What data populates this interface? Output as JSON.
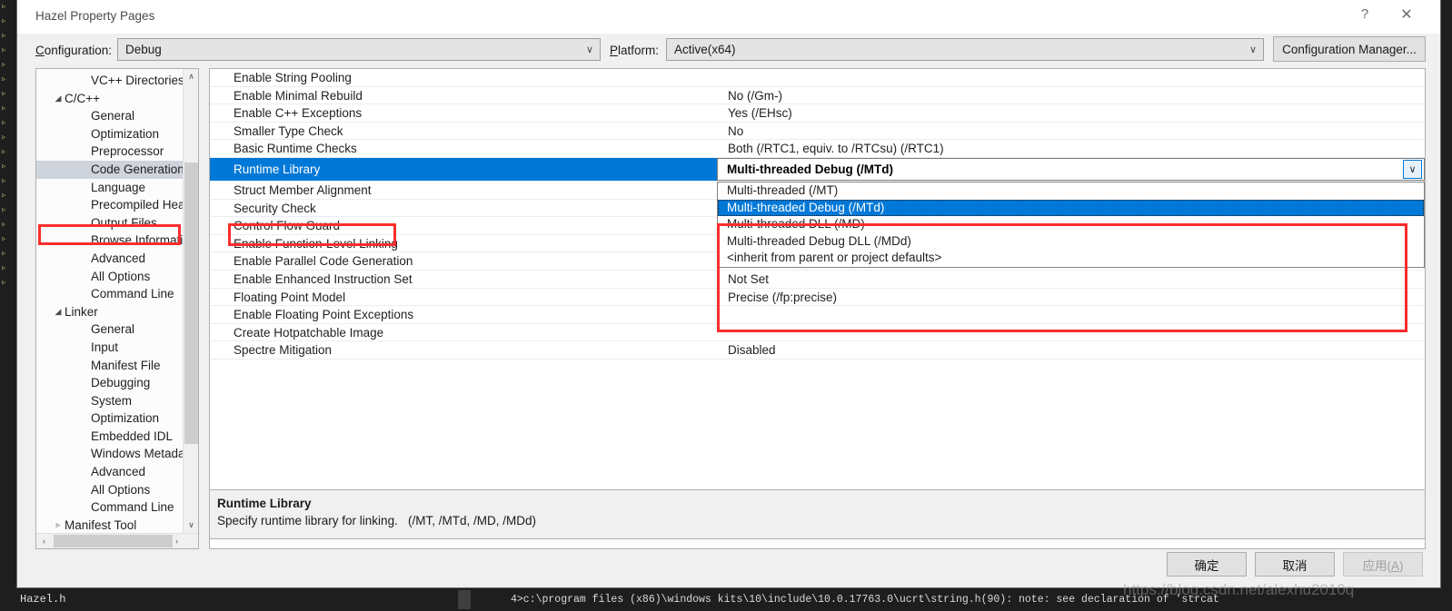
{
  "window": {
    "title": "Hazel Property Pages",
    "help_icon": "?",
    "close_icon": "✕"
  },
  "config_bar": {
    "configuration_label": "Configuration:",
    "configuration_value": "Debug",
    "platform_label": "Platform:",
    "platform_value": "Active(x64)",
    "config_manager_button": "Configuration Manager...",
    "dropdown_arrow": "∨"
  },
  "tree": {
    "items": [
      {
        "label": "VC++ Directories",
        "depth": 2,
        "twisty": "",
        "selected": false
      },
      {
        "label": "C/C++",
        "depth": 1,
        "twisty": "◢",
        "selected": false
      },
      {
        "label": "General",
        "depth": 2,
        "twisty": "",
        "selected": false
      },
      {
        "label": "Optimization",
        "depth": 2,
        "twisty": "",
        "selected": false
      },
      {
        "label": "Preprocessor",
        "depth": 2,
        "twisty": "",
        "selected": false
      },
      {
        "label": "Code Generation",
        "depth": 2,
        "twisty": "",
        "selected": true
      },
      {
        "label": "Language",
        "depth": 2,
        "twisty": "",
        "selected": false
      },
      {
        "label": "Precompiled Head",
        "depth": 2,
        "twisty": "",
        "selected": false
      },
      {
        "label": "Output Files",
        "depth": 2,
        "twisty": "",
        "selected": false
      },
      {
        "label": "Browse Informatio",
        "depth": 2,
        "twisty": "",
        "selected": false
      },
      {
        "label": "Advanced",
        "depth": 2,
        "twisty": "",
        "selected": false
      },
      {
        "label": "All Options",
        "depth": 2,
        "twisty": "",
        "selected": false
      },
      {
        "label": "Command Line",
        "depth": 2,
        "twisty": "",
        "selected": false
      },
      {
        "label": "Linker",
        "depth": 1,
        "twisty": "◢",
        "selected": false
      },
      {
        "label": "General",
        "depth": 2,
        "twisty": "",
        "selected": false
      },
      {
        "label": "Input",
        "depth": 2,
        "twisty": "",
        "selected": false
      },
      {
        "label": "Manifest File",
        "depth": 2,
        "twisty": "",
        "selected": false
      },
      {
        "label": "Debugging",
        "depth": 2,
        "twisty": "",
        "selected": false
      },
      {
        "label": "System",
        "depth": 2,
        "twisty": "",
        "selected": false
      },
      {
        "label": "Optimization",
        "depth": 2,
        "twisty": "",
        "selected": false
      },
      {
        "label": "Embedded IDL",
        "depth": 2,
        "twisty": "",
        "selected": false
      },
      {
        "label": "Windows Metadat",
        "depth": 2,
        "twisty": "",
        "selected": false
      },
      {
        "label": "Advanced",
        "depth": 2,
        "twisty": "",
        "selected": false
      },
      {
        "label": "All Options",
        "depth": 2,
        "twisty": "",
        "selected": false
      },
      {
        "label": "Command Line",
        "depth": 2,
        "twisty": "",
        "selected": false
      },
      {
        "label": "Manifest Tool",
        "depth": 1,
        "twisty": "▹",
        "selected": false
      }
    ],
    "scroll_up_icon": "∧",
    "scroll_down_icon": "∨",
    "scroll_left_icon": "‹",
    "scroll_right_icon": "›"
  },
  "grid": {
    "rows_top": [
      {
        "name": "Enable String Pooling",
        "value": ""
      },
      {
        "name": "Enable Minimal Rebuild",
        "value": "No (/Gm-)"
      },
      {
        "name": "Enable C++ Exceptions",
        "value": "Yes (/EHsc)"
      },
      {
        "name": "Smaller Type Check",
        "value": "No"
      },
      {
        "name": "Basic Runtime Checks",
        "value": "Both (/RTC1, equiv. to /RTCsu) (/RTC1)"
      }
    ],
    "active_row": {
      "name": "Runtime Library",
      "value": "Multi-threaded Debug (/MTd)",
      "combo_arrow": "∨"
    },
    "rows_bottom": [
      {
        "name": "Struct Member Alignment",
        "value": ""
      },
      {
        "name": "Security Check",
        "value": ""
      },
      {
        "name": "Control Flow Guard",
        "value": ""
      },
      {
        "name": "Enable Function-Level Linking",
        "value": ""
      },
      {
        "name": "Enable Parallel Code Generation",
        "value": ""
      },
      {
        "name": "Enable Enhanced Instruction Set",
        "value": "Not Set"
      },
      {
        "name": "Floating Point Model",
        "value": "Precise (/fp:precise)"
      },
      {
        "name": "Enable Floating Point Exceptions",
        "value": ""
      },
      {
        "name": "Create Hotpatchable Image",
        "value": ""
      },
      {
        "name": "Spectre Mitigation",
        "value": "Disabled"
      }
    ]
  },
  "dropdown": {
    "options": [
      {
        "label": "Multi-threaded (/MT)",
        "selected": false
      },
      {
        "label": "Multi-threaded Debug (/MTd)",
        "selected": true
      },
      {
        "label": "Multi-threaded DLL (/MD)",
        "selected": false
      },
      {
        "label": "Multi-threaded Debug DLL (/MDd)",
        "selected": false
      },
      {
        "label": "<inherit from parent or project defaults>",
        "selected": false
      }
    ]
  },
  "description": {
    "title": "Runtime Library",
    "text": "Specify runtime library for linking.",
    "flags": "(/MT, /MTd, /MD, /MDd)"
  },
  "footer": {
    "ok": "确定",
    "cancel": "取消",
    "apply_prefix": "应用(",
    "apply_key": "A",
    "apply_suffix": ")"
  },
  "editor_background": {
    "gutter_marks": "▹\n▹\n▹\n▹\n▹\n▹\n▹\n▹\n▹\n▹\n▹\n▹\n▹\n▹\n▹\n▹\n▹\n▹\n▹\n▹",
    "tab_name": "Hazel.h",
    "output_line": "4>c:\\program files (x86)\\windows kits\\10\\include\\10.0.17763.0\\ucrt\\string.h(90): note: see declaration of 'strcat"
  },
  "watermark": {
    "text": "https://blog.csdn.net/alexhu2010q"
  },
  "colors": {
    "accent_blue": "#0078d7",
    "annotation_red": "#fb2d2d",
    "tree_selection": "#cfd3dc",
    "dialog_bg": "#f0f0f0"
  }
}
